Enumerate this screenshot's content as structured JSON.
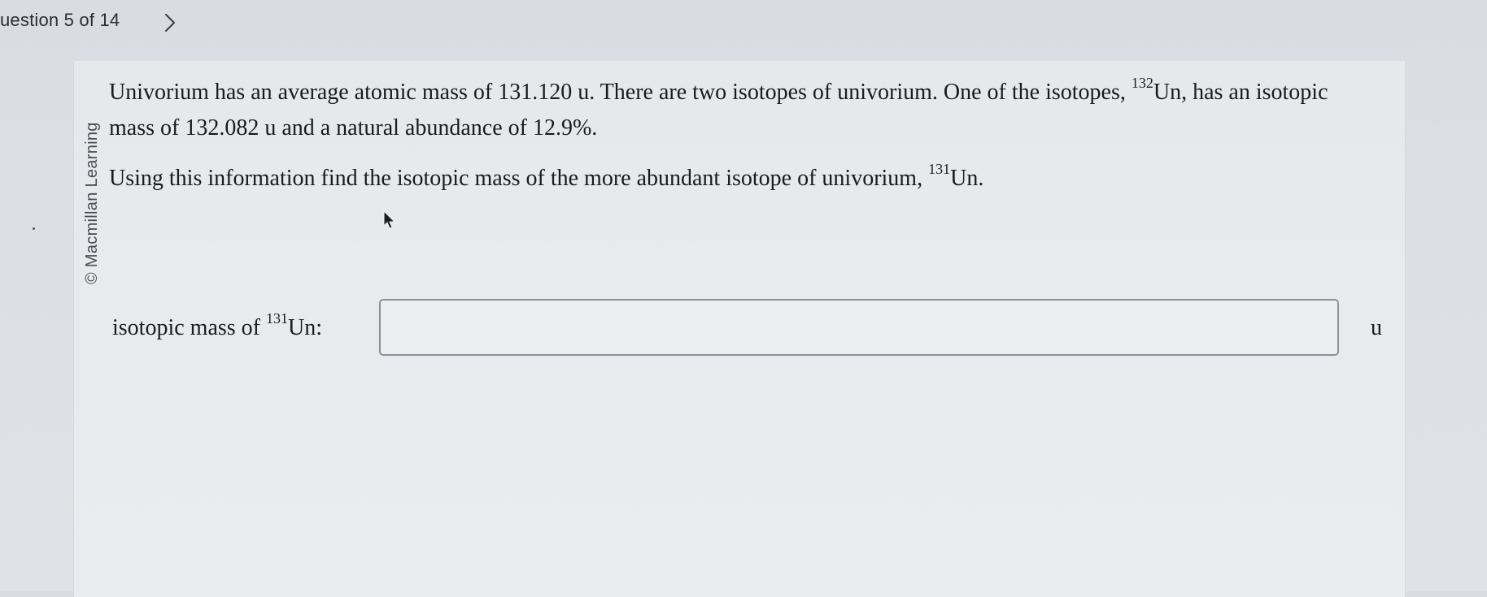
{
  "header": {
    "question_counter": "uestion 5 of 14",
    "next_icon": "chevron-right-icon"
  },
  "copyright": "© Macmillan Learning",
  "question": {
    "p1_part1": "Univorium has an average atomic mass of 131.120 u. There are two isotopes of univorium. One of the isotopes, ",
    "p1_sup": "132",
    "p1_part2": "Un, has an isotopic mass of 132.082 u and a natural abundance of 12.9%.",
    "p2_part1": "Using this information find the isotopic mass of the more abundant isotope of univorium, ",
    "p2_sup": "131",
    "p2_part2": "Un."
  },
  "answer": {
    "label_part1": "isotopic mass of ",
    "label_sup": "131",
    "label_part2": "Un:",
    "value": "",
    "placeholder": "",
    "unit": "u"
  },
  "colors": {
    "background": "#dcdfe5",
    "card": "#e8eaee",
    "input_border": "#8c9096",
    "text": "#1b1b1b"
  }
}
